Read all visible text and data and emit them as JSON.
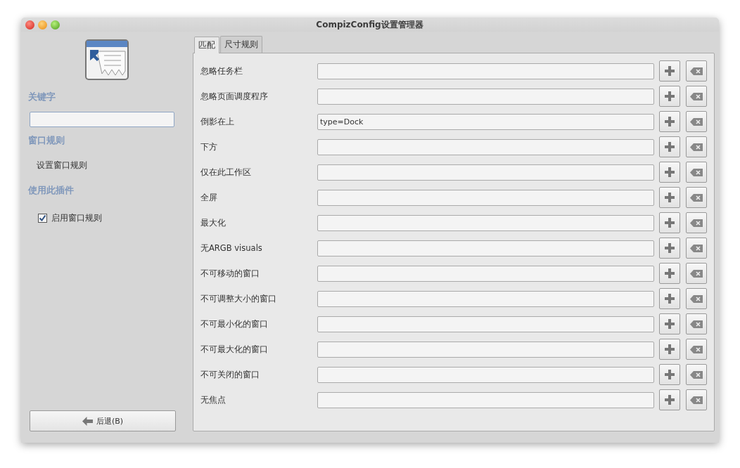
{
  "window": {
    "title": "CompizConfig设置管理器"
  },
  "sidebar": {
    "keyword_heading": "关键字",
    "section_heading": "窗口规则",
    "section_item": "设置窗口规则",
    "plugin_heading": "使用此插件",
    "enable_checkbox": {
      "label": "启用窗口规则",
      "checked": true
    },
    "back_button": "后退(B)"
  },
  "tabs": [
    {
      "label": "匹配",
      "selected": true
    },
    {
      "label": "尺寸规则",
      "selected": false
    }
  ],
  "rows": [
    {
      "label": "忽略任务栏"
    },
    {
      "label": "忽略页面调度程序"
    },
    {
      "label": "倒影在上",
      "value": "type=Dock"
    },
    {
      "label": "下方"
    },
    {
      "label": "仅在此工作区"
    },
    {
      "label": "全屏"
    },
    {
      "label": "最大化"
    },
    {
      "label": "无ARGB visuals"
    },
    {
      "label": "不可移动的窗口"
    },
    {
      "label": "不可调整大小的窗口"
    },
    {
      "label": "不可最小化的窗口"
    },
    {
      "label": "不可最大化的窗口"
    },
    {
      "label": "不可关闭的窗口"
    },
    {
      "label": "无焦点"
    }
  ]
}
